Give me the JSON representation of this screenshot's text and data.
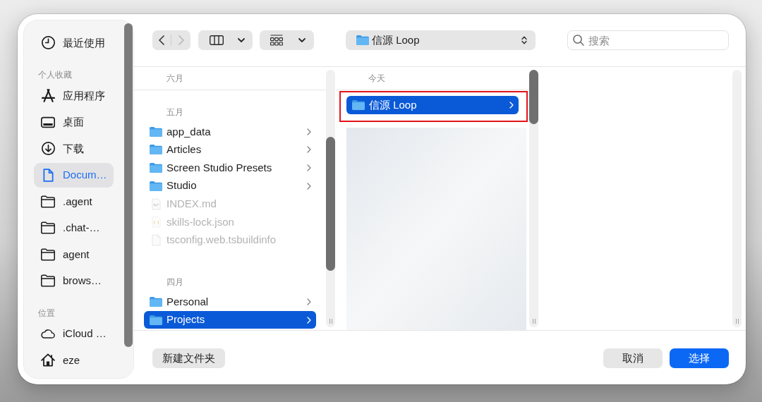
{
  "sidebar": {
    "sections": [
      {
        "items": [
          {
            "label": "最近使用",
            "kind": "clock",
            "selected": false
          }
        ]
      },
      {
        "title": "个人收藏",
        "items": [
          {
            "label": "应用程序",
            "kind": "apps",
            "selected": false
          },
          {
            "label": "桌面",
            "kind": "desktop",
            "selected": false
          },
          {
            "label": "下载",
            "kind": "downloads",
            "selected": false
          },
          {
            "label": "Docum…",
            "kind": "document",
            "selected": true
          },
          {
            "label": ".agent",
            "kind": "folder",
            "selected": false
          },
          {
            "label": ".chat-…",
            "kind": "folder",
            "selected": false
          },
          {
            "label": "agent",
            "kind": "folder",
            "selected": false
          },
          {
            "label": "brows…",
            "kind": "folder",
            "selected": false
          }
        ]
      },
      {
        "title": "位置",
        "items": [
          {
            "label": "iCloud …",
            "kind": "cloud",
            "selected": false
          },
          {
            "label": "eze",
            "kind": "home",
            "selected": false
          }
        ]
      }
    ]
  },
  "toolbar": {
    "back": {
      "disabled": false
    },
    "forward": {
      "disabled": true
    },
    "path": {
      "label": "信源 Loop"
    },
    "search": {
      "placeholder": "搜索"
    }
  },
  "columns": [
    {
      "groups": [
        {
          "title": "六月"
        },
        {
          "title": "五月",
          "items": [
            {
              "name": "app_data",
              "kind": "folder",
              "selected": false,
              "disabled": false,
              "highlighted": false
            },
            {
              "name": "Articles",
              "kind": "folder",
              "selected": false,
              "disabled": false,
              "highlighted": false
            },
            {
              "name": "Screen Studio Presets",
              "kind": "folder",
              "selected": false,
              "disabled": false,
              "highlighted": false
            },
            {
              "name": "Studio",
              "kind": "folder",
              "selected": false,
              "disabled": false,
              "highlighted": false
            },
            {
              "name": "INDEX.md",
              "kind": "markdown",
              "selected": false,
              "disabled": true,
              "highlighted": false
            },
            {
              "name": "skills-lock.json",
              "kind": "json",
              "selected": false,
              "disabled": true,
              "highlighted": false
            },
            {
              "name": "tsconfig.web.tsbuildinfo",
              "kind": "file",
              "selected": false,
              "disabled": true,
              "highlighted": false
            }
          ]
        },
        {
          "title": "四月",
          "items": [
            {
              "name": "Personal",
              "kind": "folder",
              "selected": false,
              "disabled": false,
              "highlighted": false
            },
            {
              "name": "Projects",
              "kind": "folder",
              "selected": true,
              "disabled": false,
              "highlighted": false
            }
          ]
        }
      ]
    },
    {
      "groups": [
        {
          "title": "今天",
          "items": [
            {
              "name": "信源 Loop",
              "kind": "folder",
              "selected": true,
              "disabled": false,
              "highlighted": true
            }
          ]
        }
      ]
    }
  ],
  "footer": {
    "new_folder": {
      "label": "新建文件夹"
    },
    "buttons": [
      {
        "label": "取消",
        "kind": "secondary"
      },
      {
        "label": "选择",
        "kind": "primary"
      }
    ]
  }
}
